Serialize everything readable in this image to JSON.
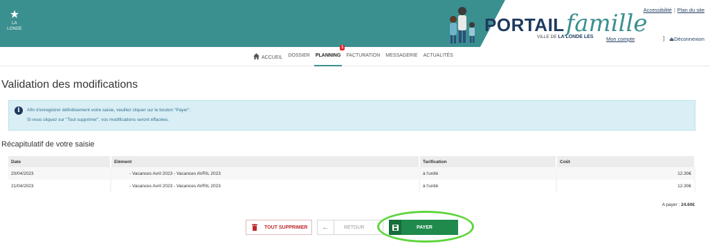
{
  "header": {
    "logo_left": "LA LONDE",
    "brand_main": "PORTAIL",
    "brand_script": "famille",
    "brand_sub_prefix": "VILLE DE",
    "brand_sub_bold": "LA LONDE LES",
    "links": {
      "accessibility": "Accessibilité",
      "sitemap": "Plan du site",
      "account": "Mon compte",
      "logout": "Déconnexion"
    },
    "colors": {
      "teal": "#3a8f8f",
      "navy": "#1e3a5f"
    }
  },
  "nav": {
    "home": "ACCUEIL",
    "dossier": "DOSSIER",
    "planning": "PLANNING",
    "planning_badge": "1",
    "facturation": "FACTURATION",
    "messagerie": "MESSAGERIE",
    "actualites": "ACTUALITÉS"
  },
  "page": {
    "title": "Validation des modifications",
    "info_line1": "Afin d'enregistrer définitivement votre saisie, veuillez cliquer sur le bouton \"Payer\".",
    "info_line2": "Si vous cliquez sur \"Tout supprimer\", vos modifications seront effacées.",
    "recap_title": "Récapitulatif de votre saisie"
  },
  "table": {
    "headers": [
      "Date",
      "Elément",
      "Tarification",
      "Coût"
    ],
    "rows": [
      {
        "date": "20/04/2023",
        "element": "- Vacances Avril 2023 - Vacances AVRIL 2023",
        "tarification": "à l'unité",
        "cout": "12.30€"
      },
      {
        "date": "21/04/2023",
        "element": "- Vacances Avril 2023 - Vacances AVRIL 2023",
        "tarification": "à l'unité",
        "cout": "12.30€"
      }
    ],
    "total_label": "A payer :",
    "total_value": "24.60€"
  },
  "buttons": {
    "delete": "TOUT SUPPRIMER",
    "back": "RETOUR",
    "pay": "PAYER"
  }
}
